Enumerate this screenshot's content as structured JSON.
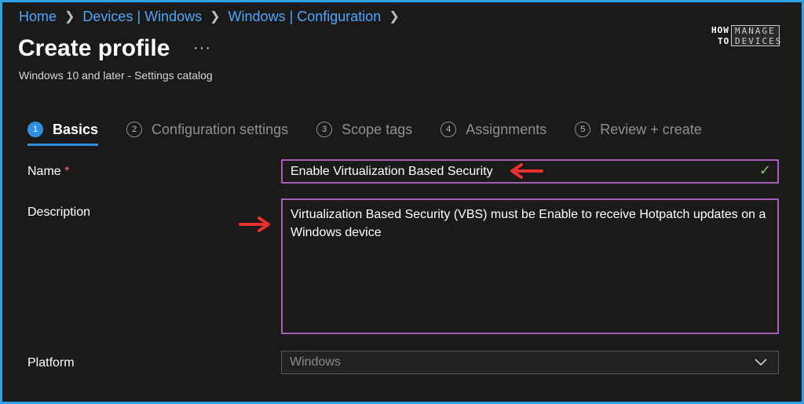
{
  "breadcrumb": {
    "items": [
      "Home",
      "Devices | Windows",
      "Windows | Configuration"
    ]
  },
  "page": {
    "title": "Create profile",
    "more": "···",
    "subtitle": "Windows 10 and later - Settings catalog"
  },
  "logo": {
    "how": "HOW",
    "to": "TO",
    "manage": "MANAGE",
    "devices": "DEVICES"
  },
  "tabs": [
    {
      "num": "1",
      "label": "Basics"
    },
    {
      "num": "2",
      "label": "Configuration settings"
    },
    {
      "num": "3",
      "label": "Scope tags"
    },
    {
      "num": "4",
      "label": "Assignments"
    },
    {
      "num": "5",
      "label": "Review + create"
    }
  ],
  "form": {
    "name_label": "Name",
    "required_mark": "*",
    "name_value": "Enable Virtualization Based Security",
    "description_label": "Description",
    "description_value": "Virtualization Based Security (VBS) must be Enable to receive Hotpatch updates on a Windows device",
    "platform_label": "Platform",
    "platform_value": "Windows"
  },
  "colors": {
    "accent": "#2f8fe0",
    "field_border": "#a35fb5",
    "annotation_arrow": "#e8312f",
    "valid_check": "#7ec27a"
  }
}
